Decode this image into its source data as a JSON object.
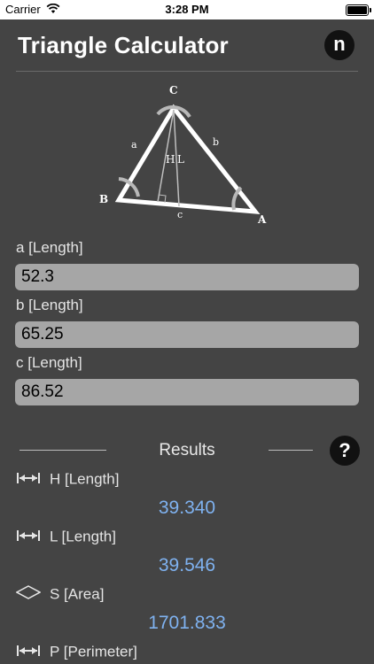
{
  "status_bar": {
    "carrier": "Carrier",
    "time": "3:28 PM"
  },
  "header": {
    "title": "Triangle Calculator",
    "logo_letter": "n"
  },
  "diagram": {
    "vertices": {
      "A": "A",
      "B": "B",
      "C": "C"
    },
    "sides": {
      "a": "a",
      "b": "b",
      "c": "c"
    },
    "height_label": "H",
    "median_label": "L"
  },
  "inputs": [
    {
      "label": "a [Length]",
      "value": "52.3"
    },
    {
      "label": "b [Length]",
      "value": "65.25"
    },
    {
      "label": "c [Length]",
      "value": "86.52"
    }
  ],
  "results": {
    "title": "Results",
    "help_label": "?",
    "items": [
      {
        "icon": "length-arrows-icon",
        "label": "H [Length]",
        "value": "39.340"
      },
      {
        "icon": "length-arrows-icon",
        "label": "L [Length]",
        "value": "39.546"
      },
      {
        "icon": "rhombus-area-icon",
        "label": "S [Area]",
        "value": "1701.833"
      },
      {
        "icon": "length-arrows-icon",
        "label": "P [Perimeter]",
        "value": ""
      }
    ]
  },
  "colors": {
    "background": "#444444",
    "result_value": "#7fb2f0",
    "input_bg": "#a6a6a6"
  }
}
